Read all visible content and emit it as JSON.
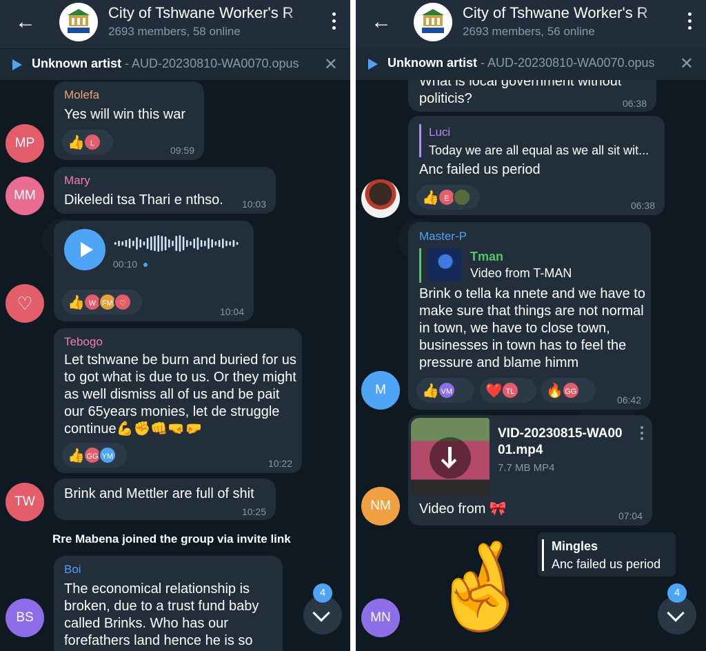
{
  "colors": {
    "accent": "#4ea4f6",
    "bubble": "#222e3a",
    "header": "#212d3b",
    "chat_bg": "#0f1922"
  },
  "panels": {
    "left": {
      "header": {
        "title": "City of Tshwane Worker's R",
        "subtitle": "2693 members, 58 online"
      },
      "player": {
        "artist": "Unknown artist",
        "separator": " - ",
        "file": "AUD-20230810-WA0070.opus"
      },
      "messages": [
        {
          "sender": "Molefa",
          "text": "Yes will win this war",
          "time": "09:59",
          "avatar": "MP",
          "reaction_users": [
            "L"
          ]
        },
        {
          "sender": "Mary",
          "text": "Dikeledi tsa Thari e nthso.",
          "time": "10:03",
          "avatar": "MM"
        },
        {
          "voice_duration": "00:10",
          "time": "10:04",
          "reaction_users": [
            "W",
            "FM"
          ]
        },
        {
          "sender": "Tebogo",
          "text": "Let tshwane be burn and buried for us to got what is due to us. Or they might as well dismiss all of us and be pait our 65years monies, let de struggle continue💪✊👊🤜🤛",
          "time": "10:22",
          "reaction_users": [
            "GG",
            "YM"
          ]
        },
        {
          "text": "Brink and Mettler are full of shit",
          "time": "10:25",
          "avatar": "TW"
        },
        {
          "sender": "Boi",
          "text": "The economical relationship is broken, due to a trust fund baby called Brinks. Who has our forefathers land hence he is so",
          "avatar": "BS"
        }
      ],
      "system": "Rre Mabena joined the group via invite link",
      "unread": "4"
    },
    "right": {
      "header": {
        "title": "City of Tshwane Worker's R",
        "subtitle": "2693 members, 56 online"
      },
      "player": {
        "artist": "Unknown artist",
        "separator": " - ",
        "file": "AUD-20230810-WA0070.opus"
      },
      "messages": [
        {
          "text": "What is local government without politicis?",
          "time": "06:38"
        },
        {
          "sender": "Luci",
          "quote": "Today we are all equal as we all sit wit...",
          "text": "Anc failed us period",
          "time": "06:38",
          "reaction_users": [
            "E"
          ]
        },
        {
          "sender": "Master-P",
          "reply_name": "Tman",
          "reply_text": "Video from T-MAN",
          "text": "Brink o tella ka nnete and we have to make sure that things are not normal in town, we have to close town, businesses in town has to feel the pressure and blame himm",
          "time": "06:42",
          "avatar": "M",
          "reaction_users": [
            "VM",
            "TL",
            "GG"
          ]
        },
        {
          "file_name_1": "VID-20230815-WA00",
          "file_name_2": "01.mp4",
          "file_size": "7.7 MB MP4",
          "text": "Video from 🎀",
          "time": "07:04",
          "avatar": "NM"
        },
        {
          "reply_name": "Mingles",
          "reply_text": "Anc failed us period",
          "sticker": "🤞",
          "avatar": "MN"
        }
      ],
      "unread": "4"
    }
  }
}
